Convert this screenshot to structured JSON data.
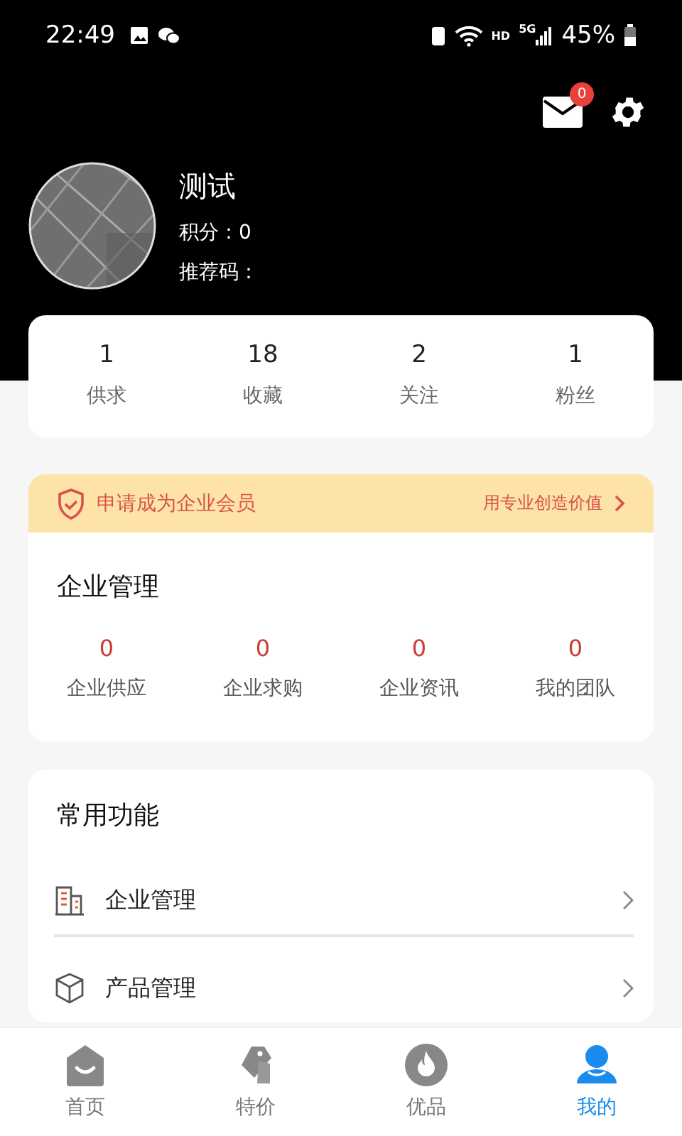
{
  "status_bar": {
    "time": "22:49",
    "network": "HD",
    "network_gen": "5G",
    "battery": "45%"
  },
  "header": {
    "message_count": "0"
  },
  "profile": {
    "name": "测试",
    "points_label": "积分：",
    "points": "0",
    "referral_label": "推荐码："
  },
  "stats": [
    {
      "value": "1",
      "label": "供求"
    },
    {
      "value": "18",
      "label": "收藏"
    },
    {
      "value": "2",
      "label": "关注"
    },
    {
      "value": "1",
      "label": "粉丝"
    }
  ],
  "membership": {
    "title": "申请成为企业会员",
    "link": "用专业创造价值"
  },
  "enterprise": {
    "title": "企业管理",
    "items": [
      {
        "value": "0",
        "label": "企业供应"
      },
      {
        "value": "0",
        "label": "企业求购"
      },
      {
        "value": "0",
        "label": "企业资讯"
      },
      {
        "value": "0",
        "label": "我的团队"
      }
    ]
  },
  "functions": {
    "title": "常用功能",
    "items": [
      {
        "kind": "building",
        "label": "企业管理"
      },
      {
        "kind": "box",
        "label": "产品管理"
      }
    ]
  },
  "tabs": [
    {
      "kind": "home",
      "label": "首页",
      "selected": false
    },
    {
      "kind": "tag",
      "label": "特价",
      "selected": false
    },
    {
      "kind": "fire",
      "label": "优品",
      "selected": false
    },
    {
      "kind": "user",
      "label": "我的",
      "selected": true
    }
  ]
}
